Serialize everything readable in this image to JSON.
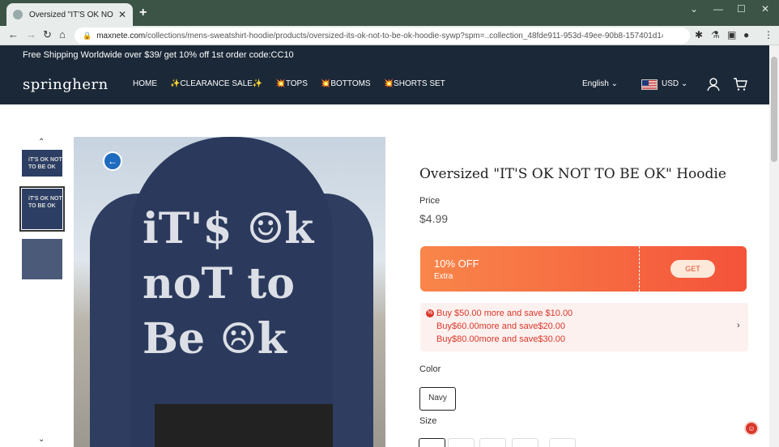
{
  "browser": {
    "tab_title": "Oversized \"IT'S OK NOT TO BE OK\" Hoodie",
    "url_domain": "maxnete.com",
    "url_path": "/collections/mens-sweatshirt-hoodie/products/oversized-its-ok-not-to-be-ok-hoodie-sywp?spm=..collection_48fde911-953d-49ee-90b8-157401d14f2d.c..."
  },
  "announcement": "Free Shipping Worldwide over $39/ get 10% off 1st order code:CC10",
  "header": {
    "logo": "springhern",
    "menu": [
      "HOME",
      "✨CLEARANCE SALE✨",
      "💥TOPS",
      "💥BOTTOMS",
      "💥SHORTS SET"
    ],
    "language": "English",
    "currency": "USD"
  },
  "gallery": {
    "thumb_text": "iT'S OK NOT TO BE OK",
    "print_lines": [
      "iT'$ ☺k",
      "noT to",
      "Be ☹k"
    ]
  },
  "product": {
    "title": "Oversized \"IT'S OK NOT TO BE OK\" Hoodie",
    "price_label": "Price",
    "price": "$4.99",
    "coupon": {
      "discount": "10% OFF",
      "sub": "Extra",
      "button": "GET"
    },
    "promos": [
      "Buy $50.00 more and save $10.00",
      "Buy$60.00more and save$20.00",
      "Buy$80.00more and save$30.00"
    ],
    "color_label": "Color",
    "color_selected": "Navy",
    "size_label": "Size"
  },
  "colors": {
    "header_bg": "#1b2838",
    "coupon_start": "#f9864a",
    "coupon_end": "#f4533a",
    "promo_text": "#d9372a"
  }
}
